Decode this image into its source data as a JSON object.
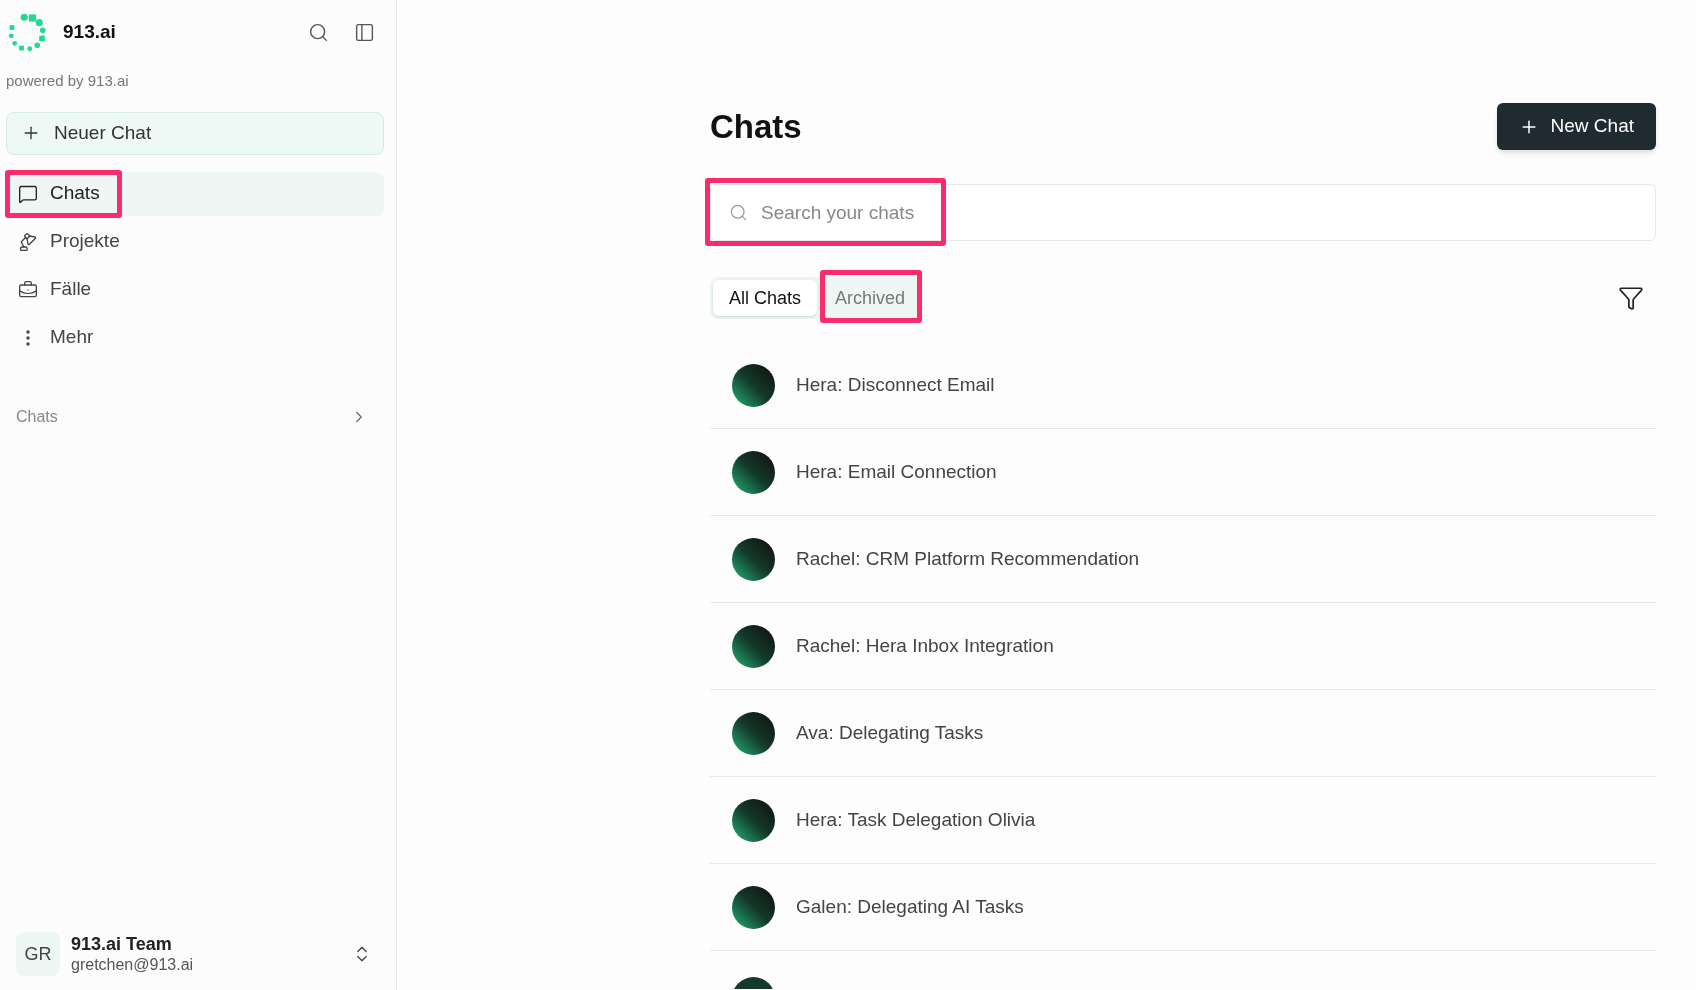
{
  "sidebar": {
    "brand": {
      "name": "913.ai",
      "tagline": "powered by 913.ai"
    },
    "new_chat_button": {
      "label": "Neuer Chat"
    },
    "nav_items": [
      {
        "label": "Chats",
        "selected": true,
        "highlighted": true
      },
      {
        "label": "Projekte",
        "selected": false,
        "highlighted": false
      },
      {
        "label": "Fälle",
        "selected": false,
        "highlighted": false
      },
      {
        "label": "Mehr",
        "selected": false,
        "highlighted": false
      }
    ],
    "section": {
      "label": "Chats",
      "expanded": false
    },
    "user": {
      "initials": "GR",
      "name": "913.ai Team",
      "email": "gretchen@913.ai"
    }
  },
  "main": {
    "title": "Chats",
    "new_chat_button": {
      "label": "New Chat"
    },
    "search": {
      "placeholder": "Search your chats",
      "highlighted": true
    },
    "tabs": [
      {
        "label": "All Chats",
        "selected": true,
        "highlighted": false
      },
      {
        "label": "Archived",
        "selected": false,
        "highlighted": true
      }
    ],
    "chats": [
      {
        "title": "Hera: Disconnect Email"
      },
      {
        "title": "Hera: Email Connection"
      },
      {
        "title": "Rachel: CRM Platform Recommendation"
      },
      {
        "title": "Rachel: Hera Inbox Integration"
      },
      {
        "title": "Ava: Delegating Tasks"
      },
      {
        "title": "Hera: Task Delegation Olivia"
      },
      {
        "title": "Galen: Delegating AI Tasks"
      }
    ],
    "more_below": true
  }
}
